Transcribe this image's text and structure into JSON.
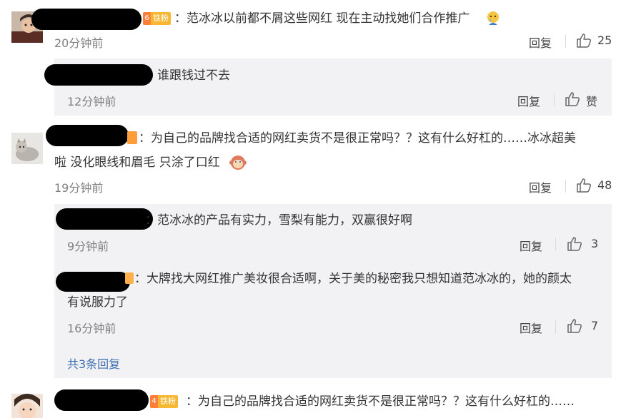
{
  "comments": [
    {
      "badge_level": "6",
      "badge_text": "铁粉",
      "text": "：范冰冰以前都不屑这些网红 现在主动找她们合作推广",
      "time": "20分钟前",
      "reply_label": "回复",
      "likes": "25"
    },
    {
      "text_line1": "：为自己的品牌找合适的网红卖货不是很正常吗？？这有什么好杠的……冰冰超美",
      "text_line2": "啦 没化眼线和眉毛 只涂了口红",
      "time": "19分钟前",
      "reply_label": "回复",
      "likes": "48",
      "replies": [
        {
          "text": "：范冰冰的产品有实力，雪梨有能力，双赢很好啊",
          "time": "9分钟前",
          "reply_label": "回复",
          "likes": "3"
        },
        {
          "text_line1": "：大牌找大网红推广美妆很合适啊，关于美的秘密我只想知道范冰冰的，她的颜太",
          "text_line2": "有说服力了",
          "time": "16分钟前",
          "reply_label": "回复",
          "likes": "7"
        }
      ],
      "more_replies": "共3条回复"
    },
    {
      "badge_level": "4",
      "badge_text": "铁粉",
      "text": "：为自己的品牌找合适的网红卖货不是很正常吗？？这有什么好杠的……"
    }
  ],
  "reply_to_first": {
    "text": "谁跟钱过不去",
    "time": "12分钟前",
    "reply_label": "回复",
    "like_label": "赞"
  },
  "colors": {
    "text": "#333333",
    "time": "#808080",
    "panel": "#f2f2f5",
    "link": "#3c6fb0"
  },
  "icons": [
    "thumbs-up-icon",
    "crying-emoji-icon",
    "monkey-emoji-icon",
    "iron-fan-badge-icon"
  ]
}
